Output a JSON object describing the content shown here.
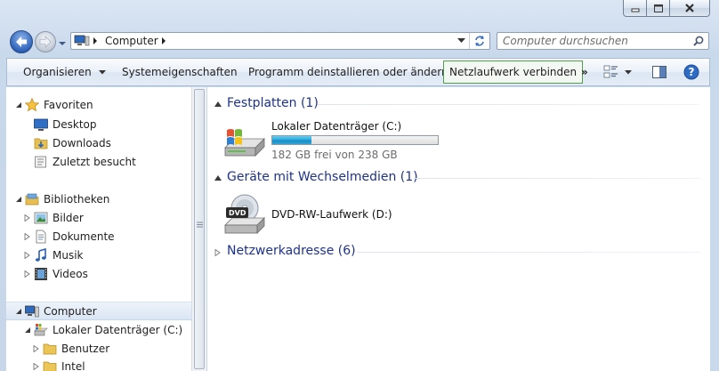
{
  "window": {
    "min_icon": "minimize-icon",
    "max_icon": "maximize-icon",
    "close_icon": "close-icon"
  },
  "nav": {
    "back_icon": "back-arrow-icon",
    "forward_icon": "forward-arrow-icon",
    "recent_icon": "chevron-down-icon"
  },
  "address": {
    "location_icon": "computer-icon",
    "crumb": "Computer"
  },
  "search": {
    "placeholder": "Computer durchsuchen",
    "icon": "magnifier-icon"
  },
  "toolbar": {
    "organize": "Organisieren",
    "system_props": "Systemeigenschaften",
    "uninstall": "Programm deinstallieren oder ändern",
    "map_drive": "Netzlaufwerk verbinden",
    "more": "»",
    "view_icon": "view-options-icon",
    "preview_icon": "preview-pane-icon",
    "help_icon": "help-icon"
  },
  "navpane": {
    "favorites": {
      "label": "Favoriten",
      "items": [
        "Desktop",
        "Downloads",
        "Zuletzt besucht"
      ]
    },
    "libraries": {
      "label": "Bibliotheken",
      "items": [
        "Bilder",
        "Dokumente",
        "Musik",
        "Videos"
      ]
    },
    "computer": {
      "label": "Computer",
      "drive": "Lokaler Datenträger (C:)",
      "folders": [
        "Benutzer",
        "Intel"
      ]
    }
  },
  "content": {
    "groups": [
      {
        "title": "Festplatten (1)",
        "expanded": true
      },
      {
        "title": "Geräte mit Wechselmedien (1)",
        "expanded": true
      },
      {
        "title": "Netzwerkadresse (6)",
        "expanded": false
      }
    ],
    "drive_c": {
      "name": "Lokaler Datenträger (C:)",
      "free_text": "182 GB frei von 238 GB",
      "used_fraction": 0.235
    },
    "dvd": {
      "name": "DVD-RW-Laufwerk (D:)",
      "badge": "DVD"
    }
  },
  "colors": {
    "group_title": "#1e3287",
    "selection": "#dbe6f4",
    "map_drive_highlight": "#4fa14f"
  }
}
